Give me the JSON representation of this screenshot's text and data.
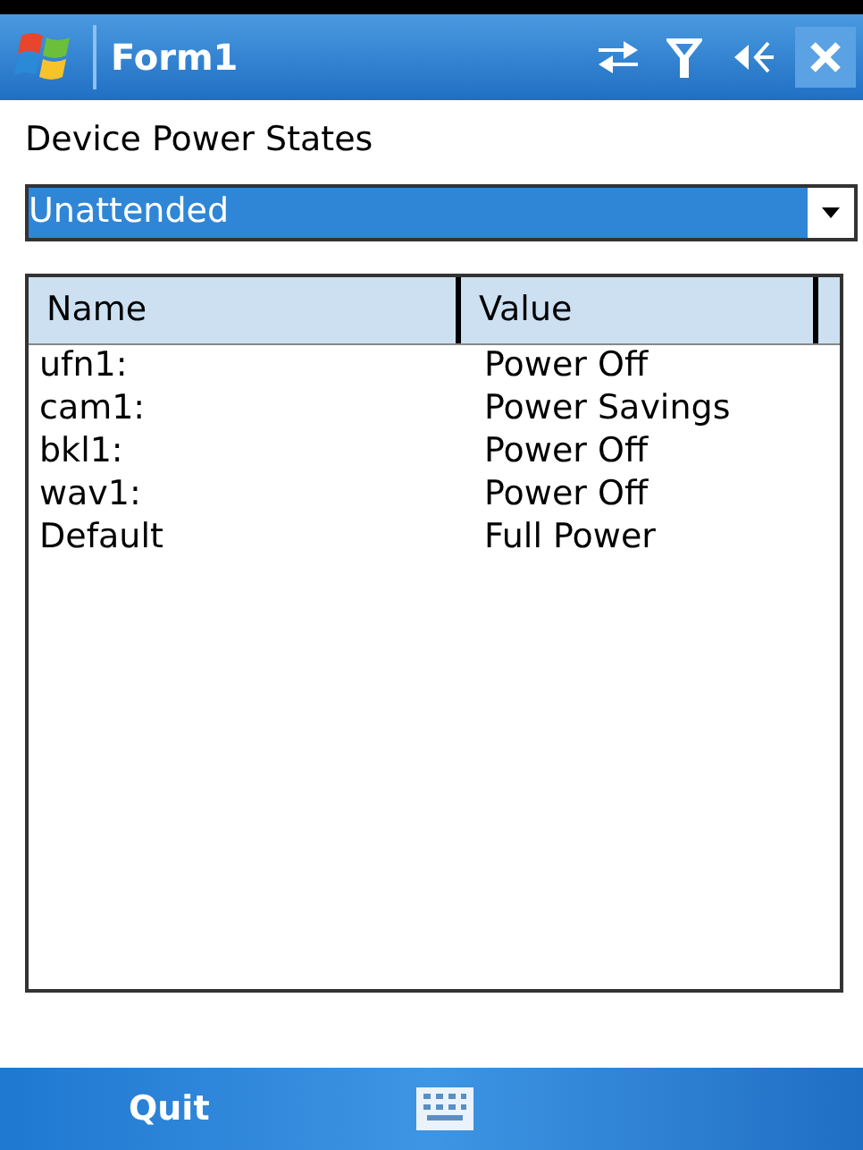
{
  "window": {
    "title": "Form1"
  },
  "heading": "Device Power States",
  "dropdown": {
    "value": "Unattended",
    "focused": true
  },
  "table": {
    "columns": [
      "Name",
      "Value"
    ],
    "rows": [
      {
        "name": "ufn1:",
        "value": "Power Off"
      },
      {
        "name": "cam1:",
        "value": "Power Savings"
      },
      {
        "name": "bkl1:",
        "value": "Power Off"
      },
      {
        "name": "wav1:",
        "value": "Power Off"
      },
      {
        "name": "Default",
        "value": "Full Power"
      }
    ]
  },
  "softkeys": {
    "left": "Quit"
  }
}
